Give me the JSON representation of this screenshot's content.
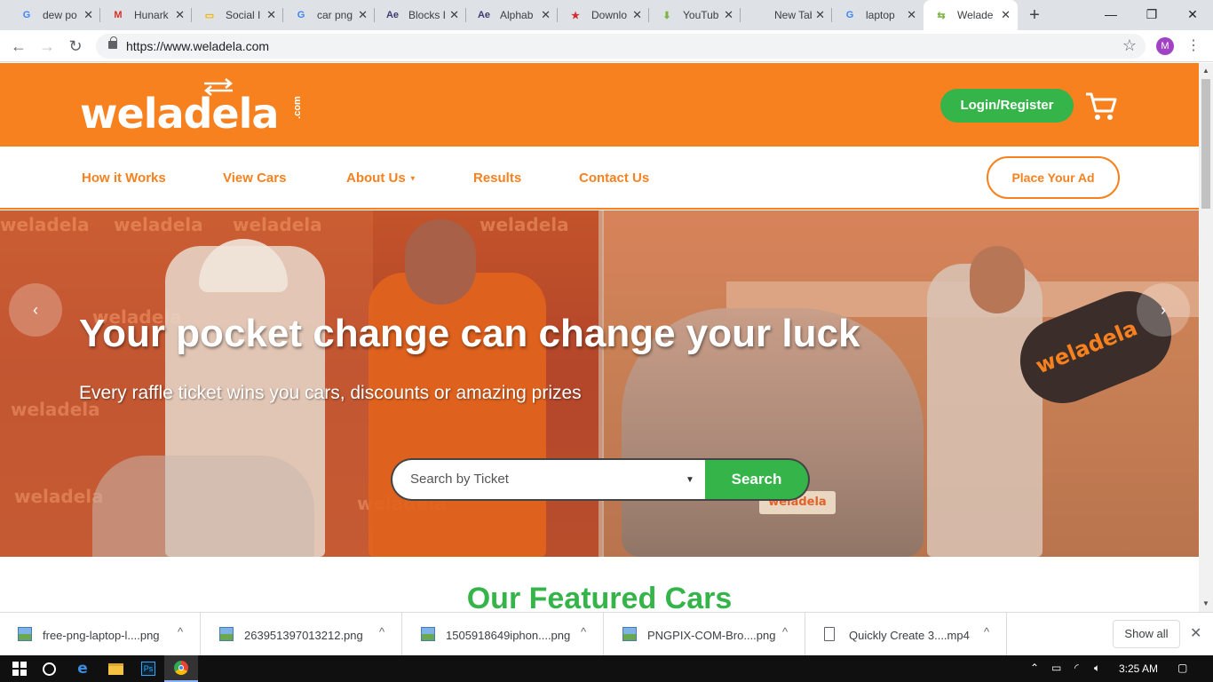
{
  "browser": {
    "tabs": [
      {
        "title": "dew po",
        "icon": "google-icon",
        "color": "#4285f4",
        "glyph": "G"
      },
      {
        "title": "Hunark",
        "icon": "gmail-icon",
        "color": "#d93025",
        "glyph": "M"
      },
      {
        "title": "Social I",
        "icon": "slides-icon",
        "color": "#f4b400",
        "glyph": "▭"
      },
      {
        "title": "car png",
        "icon": "google-icon",
        "color": "#4285f4",
        "glyph": "G"
      },
      {
        "title": "Blocks I",
        "icon": "ae-icon",
        "color": "#3d3b73",
        "glyph": "Ae"
      },
      {
        "title": "Alphab",
        "icon": "ae-icon",
        "color": "#3d3b73",
        "glyph": "Ae"
      },
      {
        "title": "Downlo",
        "icon": "star-icon",
        "color": "#d32f2f",
        "glyph": "★"
      },
      {
        "title": "YouTub",
        "icon": "download-icon",
        "color": "#7cb342",
        "glyph": "⬇"
      },
      {
        "title": "New Tab",
        "icon": "",
        "color": "#5f6368",
        "glyph": ""
      },
      {
        "title": "laptop",
        "icon": "google-icon",
        "color": "#4285f4",
        "glyph": "G"
      },
      {
        "title": "Welade",
        "icon": "weladela-arrows-icon",
        "color": "#7cb342",
        "glyph": "⇆"
      }
    ],
    "tab_close": "✕",
    "new_tab": "+",
    "window_controls": {
      "minimize": "—",
      "maximize": "❐",
      "close": "✕"
    },
    "url": "https://www.weladela.com",
    "profile_initial": "M",
    "nav": {
      "back": "←",
      "forward": "→",
      "reload": "↻",
      "star": "☆",
      "menu": "⋮"
    }
  },
  "site": {
    "logo_text": "weladela",
    "logo_suffix": ".com",
    "login_label": "Login/Register",
    "nav": {
      "how": "How it Works",
      "view": "View Cars",
      "about": "About Us",
      "results": "Results",
      "contact": "Contact Us"
    },
    "place_ad": "Place Your Ad",
    "hero": {
      "title": "Your pocket change can change your luck",
      "subtitle": "Every raffle ticket wins you cars, discounts or amazing prizes",
      "search_placeholder": "Search by Ticket",
      "search_button": "Search",
      "prev": "‹",
      "next": "›",
      "plate_text": "weladela",
      "key_text": "weladela"
    },
    "featured_title": "Our Featured Cars",
    "colors": {
      "brand_orange": "#f7811e",
      "brand_green": "#35b44a"
    }
  },
  "downloads": {
    "items": [
      {
        "name": "free-png-laptop-l....png",
        "icon": "image-file-icon"
      },
      {
        "name": "263951397013212.png",
        "icon": "image-file-icon"
      },
      {
        "name": "1505918649iphon....png",
        "icon": "image-file-icon"
      },
      {
        "name": "PNGPIX-COM-Bro....png",
        "icon": "image-file-icon"
      },
      {
        "name": "Quickly Create 3....mp4",
        "icon": "video-file-icon"
      }
    ],
    "show_all": "Show all",
    "close": "✕",
    "chevron": "^"
  },
  "taskbar": {
    "time": "3:25 AM"
  }
}
